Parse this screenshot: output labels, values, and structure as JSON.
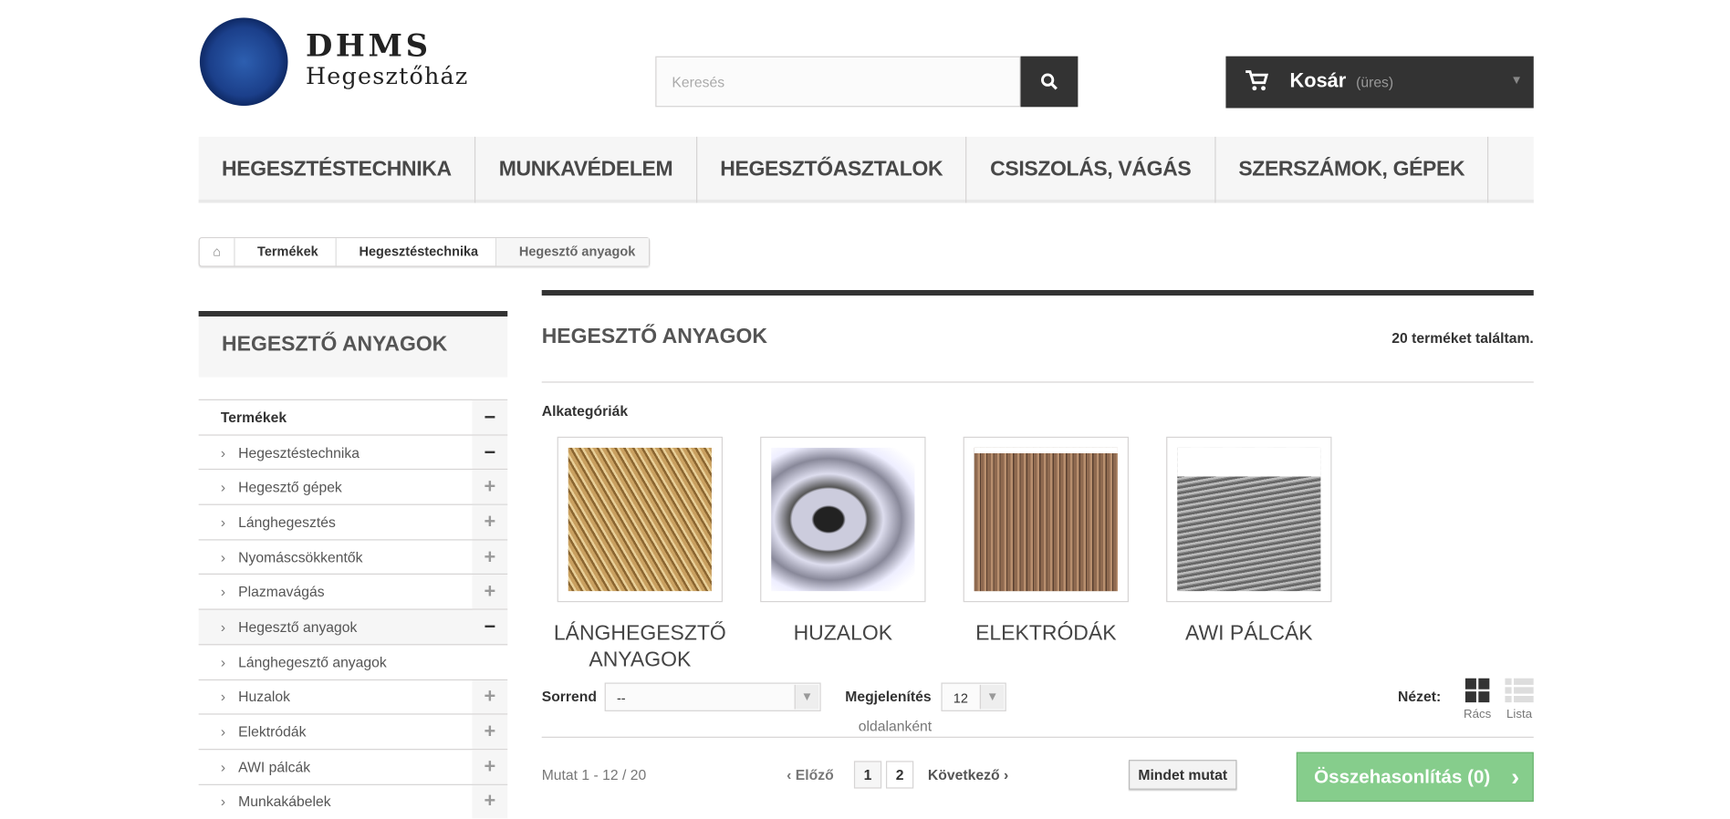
{
  "logo": {
    "title": "DHMS",
    "subtitle": "Hegesztőház"
  },
  "search": {
    "placeholder": "Keresés",
    "icon": "search-icon"
  },
  "cart": {
    "label": "Kosár",
    "status": "(üres)"
  },
  "nav": [
    "HEGESZTÉSTECHNIKA",
    "MUNKAVÉDELEM",
    "HEGESZTŐASZTALOK",
    "CSISZOLÁS, VÁGÁS",
    "SZERSZÁMOK, GÉPEK"
  ],
  "breadcrumb": [
    "Termékek",
    "Hegesztéstechnika",
    "Hegesztő anyagok"
  ],
  "sidebar": {
    "title": "HEGESZTŐ ANYAGOK",
    "items": [
      {
        "label": "Termékek",
        "toggle": "−"
      },
      {
        "label": "Hegesztéstechnika",
        "toggle": "−"
      },
      {
        "label": "Hegesztő gépek",
        "toggle": "+"
      },
      {
        "label": "Lánghegesztés",
        "toggle": "+"
      },
      {
        "label": "Nyomáscsökkentők",
        "toggle": "+"
      },
      {
        "label": "Plazmavágás",
        "toggle": "+"
      },
      {
        "label": "Hegesztő anyagok",
        "toggle": "−"
      },
      {
        "label": "Lánghegesztő anyagok",
        "toggle": ""
      },
      {
        "label": "Huzalok",
        "toggle": "+"
      },
      {
        "label": "Elektródák",
        "toggle": "+"
      },
      {
        "label": "AWI pálcák",
        "toggle": "+"
      },
      {
        "label": "Munkakábelek",
        "toggle": "+"
      }
    ]
  },
  "main": {
    "title": "HEGESZTŐ ANYAGOK",
    "count": "20 terméket találtam.",
    "subcat_label": "Alkategóriák",
    "subcategories": [
      "LÁNGHEGESZTŐ ANYAGOK",
      "HUZALOK",
      "ELEKTRÓDÁK",
      "AWI PÁLCÁK"
    ],
    "sort_label": "Sorrend",
    "sort_value": "--",
    "show_label": "Megjelenítés",
    "show_value": "12",
    "per_page": "oldalanként",
    "view_label": "Nézet:",
    "grid_label": "Rács",
    "list_label": "Lista",
    "showing": "Mutat 1 - 12 / 20",
    "prev": "Előző",
    "pages": [
      "1",
      "2"
    ],
    "next": "Következő",
    "show_all": "Mindet mutat",
    "compare": "Összehasonlítás (0)"
  }
}
